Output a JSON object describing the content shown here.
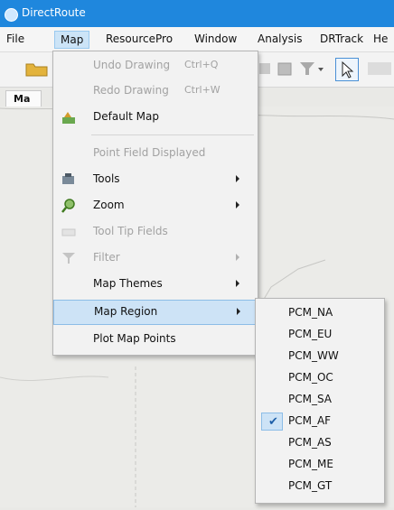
{
  "window": {
    "title": "DirectRoute"
  },
  "menubar": {
    "items": [
      "File",
      "Map",
      "ResourcePro",
      "Window",
      "Analysis",
      "DRTrack",
      "He"
    ]
  },
  "doc_tab": {
    "label": "Ma"
  },
  "map_menu": {
    "items": [
      {
        "label": "Undo Drawing",
        "shortcut": "Ctrl+Q",
        "enabled": false,
        "icon": ""
      },
      {
        "label": "Redo Drawing",
        "shortcut": "Ctrl+W",
        "enabled": false,
        "icon": ""
      },
      {
        "label": "Default Map",
        "enabled": true,
        "icon": "default-map-icon"
      },
      {
        "label": "Point Field Displayed",
        "enabled": false,
        "icon": ""
      },
      {
        "label": "Tools",
        "enabled": true,
        "submenu": true,
        "icon": "tools-icon"
      },
      {
        "label": "Zoom",
        "enabled": true,
        "submenu": true,
        "icon": "zoom-icon"
      },
      {
        "label": "Tool Tip Fields",
        "enabled": false,
        "icon": "tooltip-fields-icon"
      },
      {
        "label": "Filter",
        "enabled": false,
        "submenu": true,
        "icon": "filter-icon"
      },
      {
        "label": "Map Themes",
        "enabled": true,
        "submenu": true,
        "icon": ""
      },
      {
        "label": "Map Region",
        "enabled": true,
        "submenu": true,
        "highlighted": true,
        "icon": ""
      },
      {
        "label": "Plot Map Points",
        "enabled": true,
        "icon": ""
      }
    ]
  },
  "region_submenu": {
    "items": [
      {
        "label": "PCM_NA",
        "checked": false
      },
      {
        "label": "PCM_EU",
        "checked": false
      },
      {
        "label": "PCM_WW",
        "checked": false
      },
      {
        "label": "PCM_OC",
        "checked": false
      },
      {
        "label": "PCM_SA",
        "checked": false
      },
      {
        "label": "PCM_AF",
        "checked": true
      },
      {
        "label": "PCM_AS",
        "checked": false
      },
      {
        "label": "PCM_ME",
        "checked": false
      },
      {
        "label": "PCM_GT",
        "checked": false
      }
    ]
  },
  "colors": {
    "titlebar": "#1f87dd",
    "highlight": "#cde3f6",
    "highlight_border": "#8cbde7"
  }
}
